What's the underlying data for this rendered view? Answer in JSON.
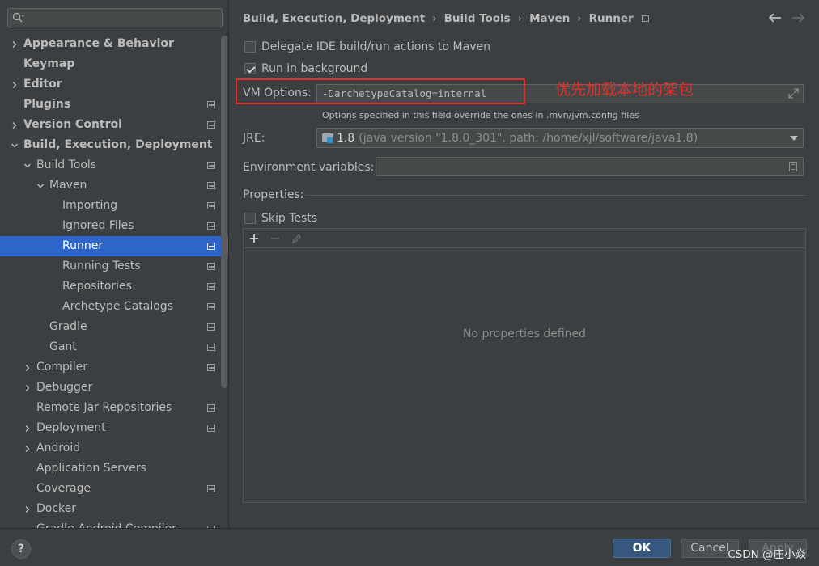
{
  "search": {
    "placeholder": "",
    "value": ""
  },
  "sidebar": {
    "items": [
      {
        "label": "Appearance & Behavior",
        "level": 0,
        "expandable": true,
        "expanded": false,
        "bold": true,
        "project_scope": false,
        "selected": false
      },
      {
        "label": "Keymap",
        "level": 0,
        "expandable": false,
        "expanded": false,
        "bold": true,
        "project_scope": false,
        "selected": false
      },
      {
        "label": "Editor",
        "level": 0,
        "expandable": true,
        "expanded": false,
        "bold": true,
        "project_scope": false,
        "selected": false
      },
      {
        "label": "Plugins",
        "level": 0,
        "expandable": false,
        "expanded": false,
        "bold": true,
        "project_scope": true,
        "selected": false
      },
      {
        "label": "Version Control",
        "level": 0,
        "expandable": true,
        "expanded": false,
        "bold": true,
        "project_scope": true,
        "selected": false
      },
      {
        "label": "Build, Execution, Deployment",
        "level": 0,
        "expandable": true,
        "expanded": true,
        "bold": true,
        "project_scope": false,
        "selected": false
      },
      {
        "label": "Build Tools",
        "level": 1,
        "expandable": true,
        "expanded": true,
        "bold": false,
        "project_scope": true,
        "selected": false
      },
      {
        "label": "Maven",
        "level": 2,
        "expandable": true,
        "expanded": true,
        "bold": false,
        "project_scope": true,
        "selected": false
      },
      {
        "label": "Importing",
        "level": 3,
        "expandable": false,
        "expanded": false,
        "bold": false,
        "project_scope": true,
        "selected": false
      },
      {
        "label": "Ignored Files",
        "level": 3,
        "expandable": false,
        "expanded": false,
        "bold": false,
        "project_scope": true,
        "selected": false
      },
      {
        "label": "Runner",
        "level": 3,
        "expandable": false,
        "expanded": false,
        "bold": false,
        "project_scope": true,
        "selected": true
      },
      {
        "label": "Running Tests",
        "level": 3,
        "expandable": false,
        "expanded": false,
        "bold": false,
        "project_scope": true,
        "selected": false
      },
      {
        "label": "Repositories",
        "level": 3,
        "expandable": false,
        "expanded": false,
        "bold": false,
        "project_scope": true,
        "selected": false
      },
      {
        "label": "Archetype Catalogs",
        "level": 3,
        "expandable": false,
        "expanded": false,
        "bold": false,
        "project_scope": true,
        "selected": false
      },
      {
        "label": "Gradle",
        "level": 2,
        "expandable": false,
        "expanded": false,
        "bold": false,
        "project_scope": true,
        "selected": false
      },
      {
        "label": "Gant",
        "level": 2,
        "expandable": false,
        "expanded": false,
        "bold": false,
        "project_scope": true,
        "selected": false
      },
      {
        "label": "Compiler",
        "level": 1,
        "expandable": true,
        "expanded": false,
        "bold": false,
        "project_scope": true,
        "selected": false
      },
      {
        "label": "Debugger",
        "level": 1,
        "expandable": true,
        "expanded": false,
        "bold": false,
        "project_scope": false,
        "selected": false
      },
      {
        "label": "Remote Jar Repositories",
        "level": 1,
        "expandable": false,
        "expanded": false,
        "bold": false,
        "project_scope": true,
        "selected": false
      },
      {
        "label": "Deployment",
        "level": 1,
        "expandable": true,
        "expanded": false,
        "bold": false,
        "project_scope": true,
        "selected": false
      },
      {
        "label": "Android",
        "level": 1,
        "expandable": true,
        "expanded": false,
        "bold": false,
        "project_scope": false,
        "selected": false
      },
      {
        "label": "Application Servers",
        "level": 1,
        "expandable": false,
        "expanded": false,
        "bold": false,
        "project_scope": false,
        "selected": false
      },
      {
        "label": "Coverage",
        "level": 1,
        "expandable": false,
        "expanded": false,
        "bold": false,
        "project_scope": true,
        "selected": false
      },
      {
        "label": "Docker",
        "level": 1,
        "expandable": true,
        "expanded": false,
        "bold": false,
        "project_scope": false,
        "selected": false
      },
      {
        "label": "Gradle-Android Compiler",
        "level": 1,
        "expandable": false,
        "expanded": false,
        "bold": false,
        "project_scope": true,
        "selected": false
      }
    ]
  },
  "breadcrumb": [
    "Build, Execution, Deployment",
    "Build Tools",
    "Maven",
    "Runner"
  ],
  "options": {
    "delegate": {
      "label": "Delegate IDE build/run actions to Maven",
      "checked": false
    },
    "background": {
      "label": "Run in background",
      "checked": true
    },
    "skip_tests": {
      "label": "Skip Tests",
      "checked": false
    }
  },
  "vm": {
    "label": "VM Options:",
    "value": "-DarchetypeCatalog=internal",
    "hint": "Options specified in this field override the ones in .mvn/jvm.config files",
    "annotation": "优先加载本地的架包"
  },
  "jre": {
    "label": "JRE:",
    "version": "1.8",
    "detail": "(java version \"1.8.0_301\", path: /home/xjl/software/java1.8)"
  },
  "env": {
    "label": "Environment variables:",
    "value": ""
  },
  "properties": {
    "label": "Properties:",
    "empty_text": "No properties defined"
  },
  "footer": {
    "help": "?",
    "ok": "OK",
    "cancel": "Cancel",
    "apply": "Apply",
    "watermark": "CSDN @庄小焱"
  },
  "colors": {
    "selection": "#2f65ca",
    "annotation": "#e0302a",
    "ok_button": "#365880"
  }
}
